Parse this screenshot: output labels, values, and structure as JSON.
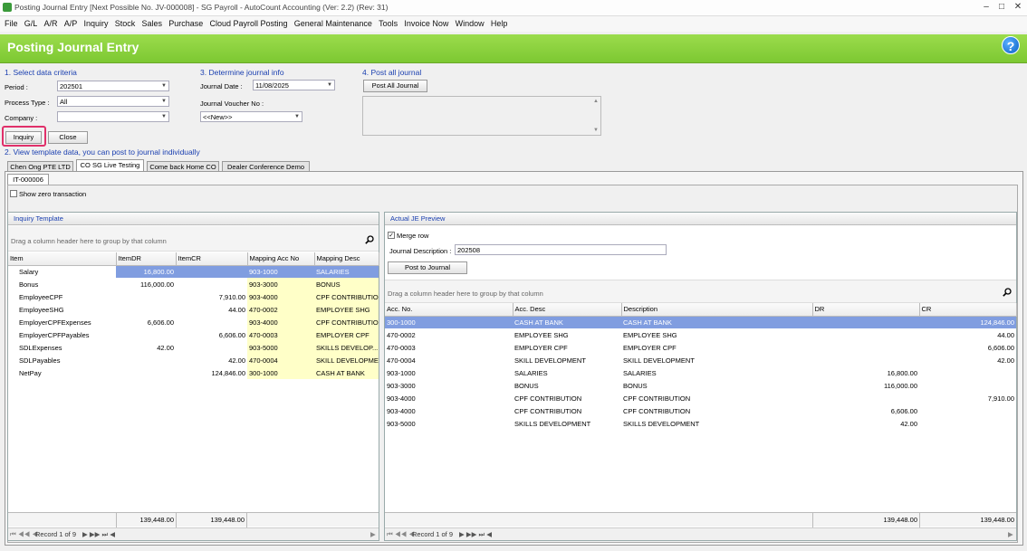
{
  "window": {
    "title": "Posting Journal Entry [Next Possible No. JV-000008] - SG Payroll - AutoCount Accounting (Ver: 2.2) (Rev: 31)",
    "minimize": "–",
    "maximize": "□",
    "close": "✕"
  },
  "menu": [
    "File",
    "G/L",
    "A/R",
    "A/P",
    "Inquiry",
    "Stock",
    "Sales",
    "Purchase",
    "Cloud Payroll Posting",
    "General Maintenance",
    "Tools",
    "Invoice Now",
    "Window",
    "Help"
  ],
  "banner": {
    "title": "Posting Journal Entry",
    "help": "?"
  },
  "criteria": {
    "heading": "1. Select data criteria",
    "period_label": "Period :",
    "period": "202501",
    "process_type_label": "Process Type :",
    "process_type": "All",
    "company_label": "Company :",
    "company": "",
    "inquiry_btn": "Inquiry",
    "close_btn": "Close"
  },
  "journal_info": {
    "heading": "3. Determine journal info",
    "date_label": "Journal Date :",
    "date": "11/08/2025",
    "voucher_label": "Journal Voucher No :",
    "voucher": "<<New>>"
  },
  "post_all": {
    "heading": "4. Post all journal",
    "button": "Post All Journal"
  },
  "view": {
    "heading": "2. View template data, you can post to journal individually"
  },
  "tabs": [
    "Chen Ong PTE LTD",
    "CO SG Live Testing",
    "Come back Home CO",
    "Dealer Conference Demo"
  ],
  "subtab": "IT-000006",
  "show_zero": "Show zero transaction",
  "inquiry": {
    "title": "Inquiry Template",
    "group_hint": "Drag a column header here to group by that column",
    "columns": [
      "Item",
      "ItemDR",
      "ItemCR",
      "Mapping Acc No",
      "Mapping Desc"
    ],
    "rows": [
      [
        "Salary",
        "16,800.00",
        "",
        "903-1000",
        "SALARIES"
      ],
      [
        "Bonus",
        "116,000.00",
        "",
        "903-3000",
        "BONUS"
      ],
      [
        "EmployeeCPF",
        "",
        "7,910.00",
        "903-4000",
        "CPF CONTRIBUTION"
      ],
      [
        "EmployeeSHG",
        "",
        "44.00",
        "470-0002",
        "EMPLOYEE SHG"
      ],
      [
        "EmployerCPFExpenses",
        "6,606.00",
        "",
        "903-4000",
        "CPF CONTRIBUTION"
      ],
      [
        "EmployerCPFPayables",
        "",
        "6,606.00",
        "470-0003",
        "EMPLOYER CPF"
      ],
      [
        "SDLExpenses",
        "42.00",
        "",
        "903-5000",
        "SKILLS DEVELOP..."
      ],
      [
        "SDLPayables",
        "",
        "42.00",
        "470-0004",
        "SKILL DEVELOPME..."
      ],
      [
        "NetPay",
        "",
        "124,846.00",
        "300-1000",
        "CASH AT BANK"
      ]
    ],
    "total_dr": "139,448.00",
    "total_cr": "139,448.00",
    "record": "Record 1 of 9"
  },
  "preview": {
    "title": "Actual JE Preview",
    "merge_row": "Merge row",
    "desc_label": "Journal Description :",
    "desc": "202508",
    "post_btn": "Post to Journal",
    "group_hint": "Drag a column header here to group by that column",
    "columns": [
      "Acc. No.",
      "Acc. Desc",
      "Description",
      "DR",
      "CR"
    ],
    "rows": [
      [
        "300-1000",
        "CASH AT BANK",
        "CASH AT BANK",
        "",
        "124,846.00"
      ],
      [
        "470-0002",
        "EMPLOYEE SHG",
        "EMPLOYEE SHG",
        "",
        "44.00"
      ],
      [
        "470-0003",
        "EMPLOYER CPF",
        "EMPLOYER CPF",
        "",
        "6,606.00"
      ],
      [
        "470-0004",
        "SKILL DEVELOPMENT",
        "SKILL DEVELOPMENT",
        "",
        "42.00"
      ],
      [
        "903-1000",
        "SALARIES",
        "SALARIES",
        "16,800.00",
        ""
      ],
      [
        "903-3000",
        "BONUS",
        "BONUS",
        "116,000.00",
        ""
      ],
      [
        "903-4000",
        "CPF CONTRIBUTION",
        "CPF CONTRIBUTION",
        "",
        "7,910.00"
      ],
      [
        "903-4000",
        "CPF CONTRIBUTION",
        "CPF CONTRIBUTION",
        "6,606.00",
        ""
      ],
      [
        "903-5000",
        "SKILLS DEVELOPMENT",
        "SKILLS DEVELOPMENT",
        "42.00",
        ""
      ]
    ],
    "total_dr": "139,448.00",
    "total_cr": "139,448.00",
    "record": "Record 1 of 9"
  },
  "colors": {
    "banner": "#7dc832",
    "section": "#1a3fb0",
    "selected_row": "#809de0",
    "mapping_bg": "#ffffc8",
    "highlight_box": "#e0306a"
  }
}
